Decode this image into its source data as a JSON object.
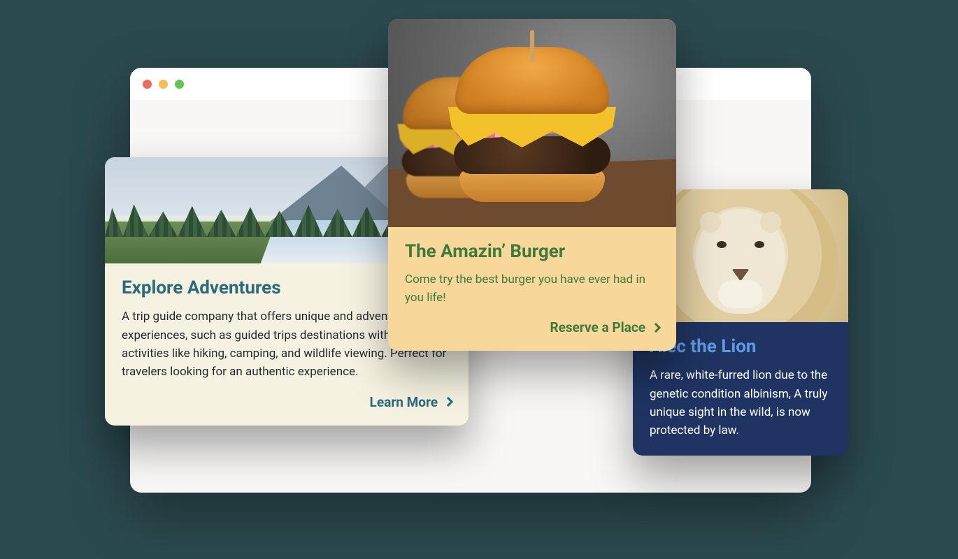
{
  "cards": {
    "adventures": {
      "title": "Explore Adventures",
      "desc": "A trip guide company that offers unique and adventure experiences, such as guided trips destinations with outdoor activities like hiking, camping, and wildlife viewing. Perfect for travelers looking for an authentic experience.",
      "cta": "Learn More",
      "image_name": "mountain-landscape"
    },
    "burger": {
      "title": "The Amazin’ Burger",
      "desc": "Come try the best burger you have ever had in you life!",
      "cta": "Reserve a Place",
      "image_name": "burger-photo"
    },
    "lion": {
      "title": "Alec the Lion",
      "desc": "A rare, white-furred lion due to the genetic condition albinism, A truly unique sight in the wild, is now protected by law.",
      "image_name": "white-lion"
    }
  },
  "colors": {
    "page_bg": "#2b4a4f",
    "adv_bg": "#f6f2e1",
    "adv_accent": "#2a6a7d",
    "burger_bg": "#f7d79a",
    "burger_accent": "#3f7a3b",
    "lion_bg": "#1f3462",
    "lion_accent": "#5e9be0"
  }
}
